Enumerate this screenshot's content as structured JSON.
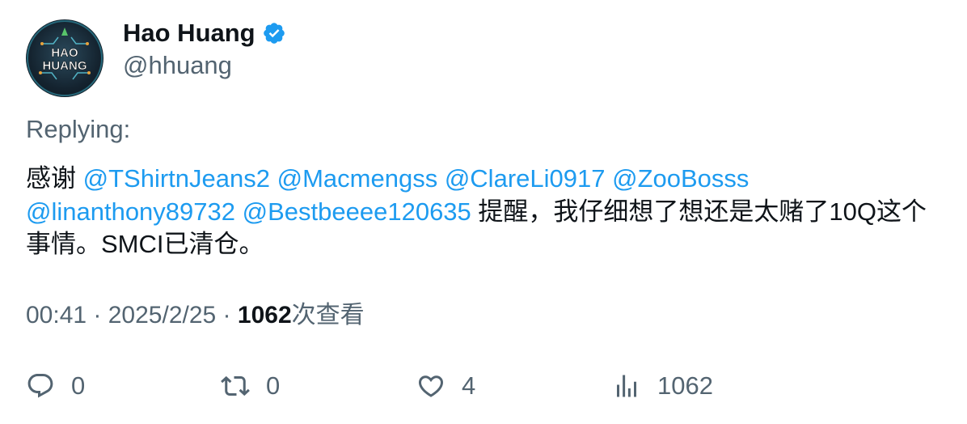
{
  "user": {
    "display_name": "Hao Huang",
    "handle": "@hhuang",
    "verified": true,
    "avatar_text_line1": "HAO",
    "avatar_text_line2": "HUANG"
  },
  "tweet": {
    "replying_label": "Replying:",
    "segments": [
      {
        "text": "感谢 ",
        "type": "text"
      },
      {
        "text": "@TShirtnJeans2",
        "type": "mention"
      },
      {
        "text": " ",
        "type": "text"
      },
      {
        "text": "@Macmengss",
        "type": "mention"
      },
      {
        "text": " ",
        "type": "text"
      },
      {
        "text": "@ClareLi0917",
        "type": "mention"
      },
      {
        "text": " ",
        "type": "text"
      },
      {
        "text": "@ZooBosss",
        "type": "mention"
      },
      {
        "text": " ",
        "type": "text"
      },
      {
        "text": "@linanthony89732",
        "type": "mention"
      },
      {
        "text": " ",
        "type": "text"
      },
      {
        "text": "@Bestbeeee120635",
        "type": "mention"
      },
      {
        "text": " 提醒，我仔细想了想还是太赌了10Q这个事情。SMCI已清仓。",
        "type": "text"
      }
    ],
    "time": "00:41",
    "date": "2025/2/25",
    "views_count": "1062",
    "views_label": "次查看"
  },
  "actions": {
    "reply_count": "0",
    "retweet_count": "0",
    "like_count": "4",
    "views_count": "1062"
  },
  "colors": {
    "mention": "#1d9bf0",
    "secondary": "#536471",
    "primary_text": "#0f1419",
    "verified_badge": "#1d9bf0"
  }
}
